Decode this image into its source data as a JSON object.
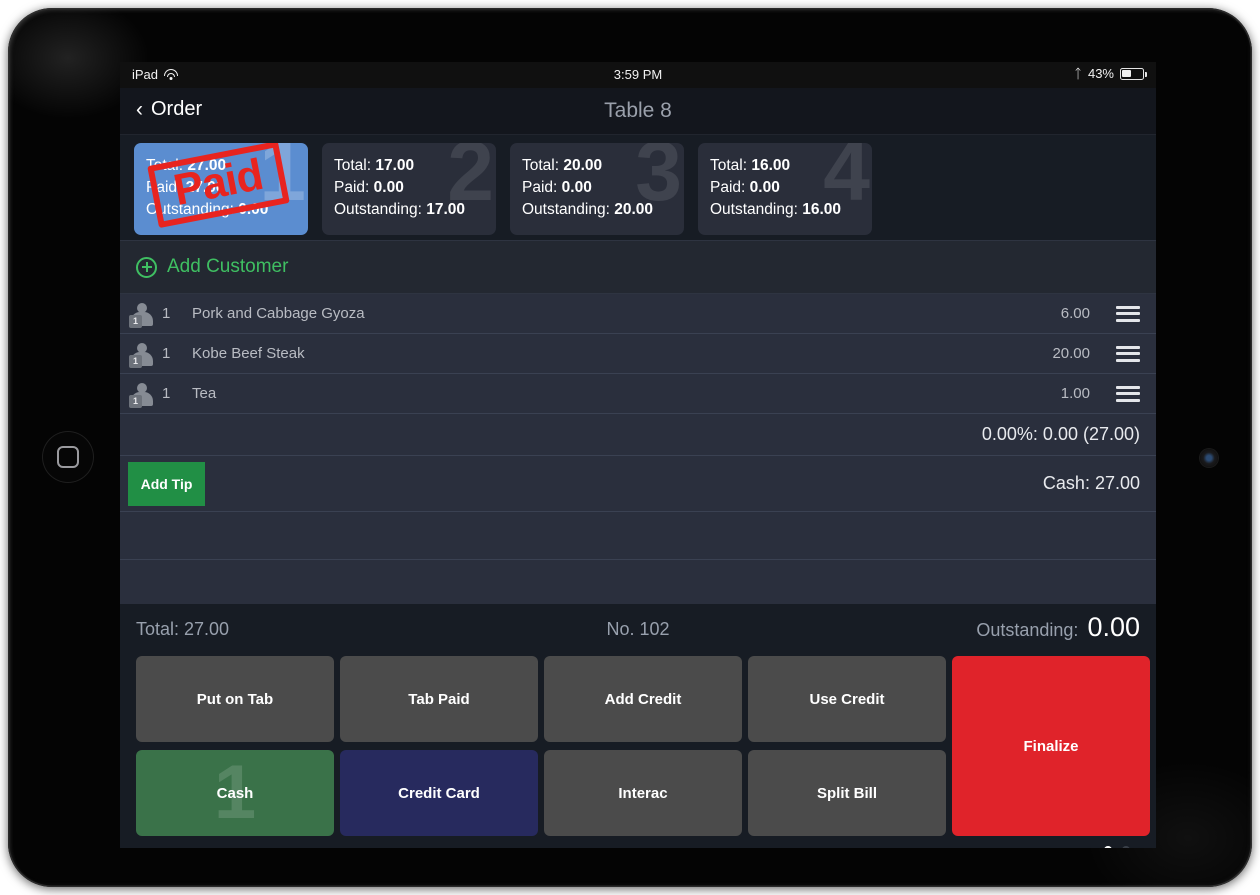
{
  "status_bar": {
    "device_label": "iPad",
    "wifi_icon": "wifi-icon",
    "time": "3:59 PM",
    "bluetooth_icon": "bluetooth-icon",
    "battery_percent": "43%",
    "battery_level": 43
  },
  "nav": {
    "back_chevron": "‹",
    "back_label": "Order",
    "title": "Table 8"
  },
  "customer_tabs": [
    {
      "number": "1",
      "total_label": "Total:",
      "total": "27.00",
      "paid_label": "Paid:",
      "paid": "27.00",
      "outstanding_label": "Outstanding:",
      "outstanding": "0.00",
      "selected": true,
      "stamp": "Paid"
    },
    {
      "number": "2",
      "total_label": "Total:",
      "total": "17.00",
      "paid_label": "Paid:",
      "paid": "0.00",
      "outstanding_label": "Outstanding:",
      "outstanding": "17.00",
      "selected": false,
      "stamp": ""
    },
    {
      "number": "3",
      "total_label": "Total:",
      "total": "20.00",
      "paid_label": "Paid:",
      "paid": "0.00",
      "outstanding_label": "Outstanding:",
      "outstanding": "20.00",
      "selected": false,
      "stamp": ""
    },
    {
      "number": "4",
      "total_label": "Total:",
      "total": "16.00",
      "paid_label": "Paid:",
      "paid": "0.00",
      "outstanding_label": "Outstanding:",
      "outstanding": "16.00",
      "selected": false,
      "stamp": ""
    }
  ],
  "add_customer": {
    "icon": "plus-circle-icon",
    "label": "Add Customer"
  },
  "order_items": [
    {
      "seat": "1",
      "seat_icon": "person-icon",
      "qty": "1",
      "name": "Pork and Cabbage Gyoza",
      "price": "6.00",
      "menu_icon": "hamburger-menu-icon"
    },
    {
      "seat": "1",
      "seat_icon": "person-icon",
      "qty": "1",
      "name": "Kobe Beef Steak",
      "price": "20.00",
      "menu_icon": "hamburger-menu-icon"
    },
    {
      "seat": "1",
      "seat_icon": "person-icon",
      "qty": "1",
      "name": "Tea",
      "price": "1.00",
      "menu_icon": "hamburger-menu-icon"
    }
  ],
  "tax_row": {
    "text": "0.00%: 0.00 (27.00)"
  },
  "tip_row": {
    "add_tip_label": "Add Tip",
    "payment_text": "Cash: 27.00"
  },
  "footer": {
    "total_label": "Total:",
    "total_value": "27.00",
    "total_text": "Total:  27.00",
    "order_no": "No. 102",
    "outstanding_label": "Outstanding:",
    "outstanding_value": "0.00"
  },
  "action_buttons": [
    {
      "label": "Put on Tab",
      "style": "grey",
      "watermark": ""
    },
    {
      "label": "Tab Paid",
      "style": "grey",
      "watermark": ""
    },
    {
      "label": "Add Credit",
      "style": "grey",
      "watermark": ""
    },
    {
      "label": "Use Credit",
      "style": "grey",
      "watermark": ""
    },
    {
      "label": "Cash",
      "style": "green",
      "watermark": "1"
    },
    {
      "label": "Credit Card",
      "style": "navy",
      "watermark": ""
    },
    {
      "label": "Interac",
      "style": "grey",
      "watermark": ""
    },
    {
      "label": "Split Bill",
      "style": "grey",
      "watermark": ""
    },
    {
      "label": "Finalize",
      "style": "red",
      "watermark": ""
    }
  ],
  "page_dots": {
    "count": 2,
    "active_index": 0
  },
  "colors": {
    "accent_green": "#3fbf62",
    "tip_green": "#218f45",
    "cash_green": "#3a7249",
    "credit_navy": "#272a5e",
    "finalize_red": "#e0232a",
    "stamp_red": "#e8241f",
    "selected_tab_blue": "#5b8dd0",
    "panel_bg": "#2a2f3d",
    "screen_bg": "#171c24"
  }
}
